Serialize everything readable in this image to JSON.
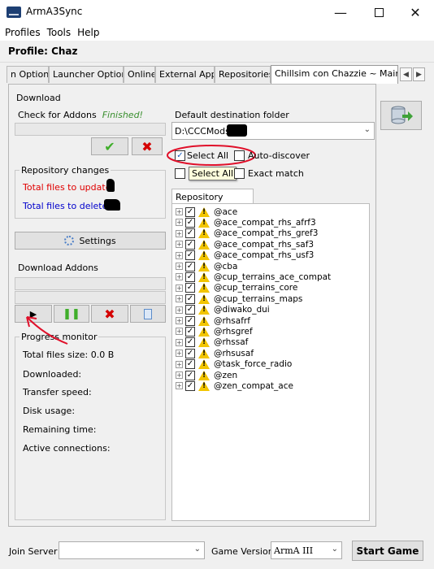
{
  "app": {
    "title": "ArmA3Sync"
  },
  "menu": [
    "Profiles",
    "Tools",
    "Help"
  ],
  "profile_label": "Profile: Chaz",
  "tabs": [
    "n Options",
    "Launcher Options",
    "Online",
    "External Apps",
    "Repositories",
    "Chillsim con Chazzie ~ Main"
  ],
  "download_panel": {
    "title": "Download",
    "check_addons_label": "Check for Addons",
    "check_status": "Finished!",
    "repo_changes_title": "Repository changes",
    "total_update_label": "Total files to update:",
    "total_delete_label": "Total files to delete :",
    "settings_label": "Settings",
    "download_addons_label": "Download Addons",
    "progress_title": "Progress monitor",
    "total_size_label": "Total files size: 0.0 B",
    "downloaded_label": "Downloaded:",
    "transfer_speed_label": "Transfer speed:",
    "disk_usage_label": "Disk usage:",
    "remaining_label": "Remaining time:",
    "connections_label": "Active connections:"
  },
  "destination": {
    "label": "Default destination folder",
    "value": "D:\\CCCMods\\"
  },
  "options": {
    "select_all": "Select All",
    "auto_discover": "Auto-discover",
    "exact_match": "Exact match",
    "tooltip": "Select All"
  },
  "repo_content": {
    "tab": "Repository content",
    "items": [
      "@ace",
      "@ace_compat_rhs_afrf3",
      "@ace_compat_rhs_gref3",
      "@ace_compat_rhs_saf3",
      "@ace_compat_rhs_usf3",
      "@cba",
      "@cup_terrains_ace_compat",
      "@cup_terrains_core",
      "@cup_terrains_maps",
      "@diwako_dui",
      "@rhsafrf",
      "@rhsgref",
      "@rhssaf",
      "@rhsusaf",
      "@task_force_radio",
      "@zen",
      "@zen_compat_ace"
    ]
  },
  "bottom": {
    "join_server_label": "Join Server",
    "game_version_label": "Game Version",
    "game_version_value": "ArmA III",
    "start_game_label": "Start Game"
  }
}
